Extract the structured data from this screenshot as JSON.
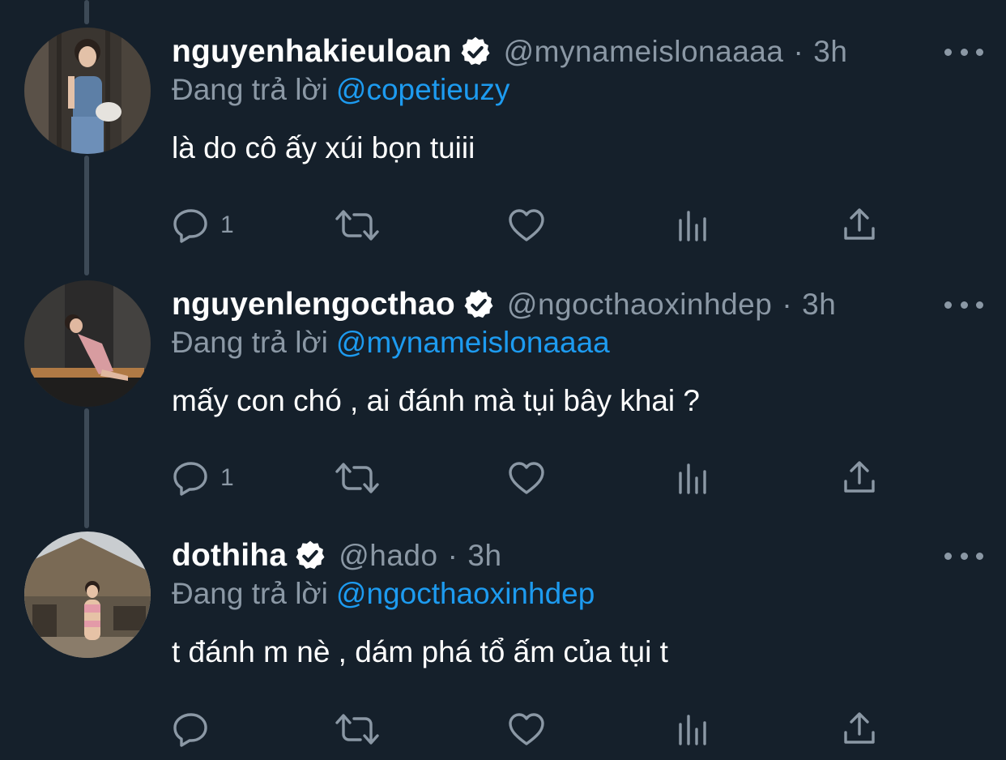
{
  "reply_prefix": "Đang trả lời",
  "colors": {
    "background": "#15202b",
    "secondary_text": "#8b98a5",
    "mention": "#1d9bf0",
    "thread_line": "#3d4a57"
  },
  "tweets": [
    {
      "name": "nguyenhakieuloan",
      "verified": true,
      "handle": "@mynameislonaaaa",
      "separator": "·",
      "time": "3h",
      "reply_to": "@copetieuzy",
      "text": "là do cô ấy xúi bọn tuiii",
      "reply_count": "1",
      "avatar_icon": "avatar-photo"
    },
    {
      "name": "nguyenlengocthao",
      "verified": true,
      "handle": "@ngocthaoxinhdep",
      "separator": "·",
      "time": "3h",
      "reply_to": "@mynameislonaaaa",
      "text": "mấy con chó , ai đánh mà tụi bây khai ?",
      "reply_count": "1",
      "avatar_icon": "avatar-photo"
    },
    {
      "name": "dothiha",
      "verified": true,
      "handle": "@hado",
      "separator": "·",
      "time": "3h",
      "reply_to": "@ngocthaoxinhdep",
      "text": "t đánh m nè , dám phá tổ ấm của tụi t",
      "reply_count": "",
      "avatar_icon": "avatar-photo"
    }
  ],
  "action_icons": [
    "reply-icon",
    "retweet-icon",
    "like-icon",
    "analytics-icon",
    "share-icon"
  ]
}
